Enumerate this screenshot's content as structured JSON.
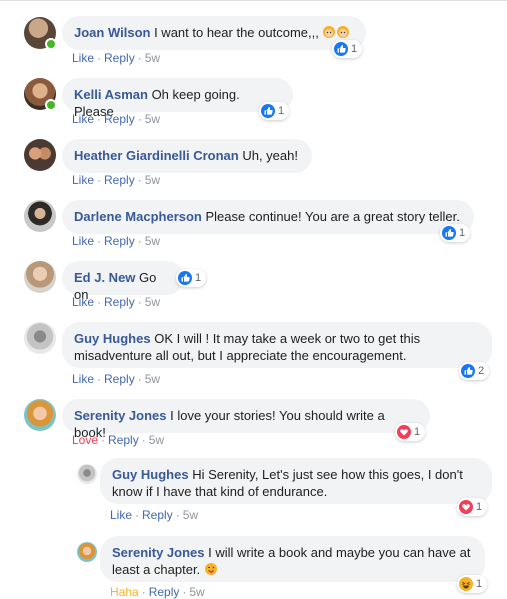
{
  "comments": [
    {
      "name": "Joan Wilson",
      "text": "I want to hear the outcome,,,",
      "like": "Like",
      "reply": "Reply",
      "time": "5w",
      "reaction_count": "1"
    },
    {
      "name": "Kelli Asman",
      "text": "Oh keep going. Please",
      "like": "Like",
      "reply": "Reply",
      "time": "5w",
      "reaction_count": "1"
    },
    {
      "name": "Heather Giardinelli Cronan",
      "text": "Uh, yeah!",
      "like": "Like",
      "reply": "Reply",
      "time": "5w"
    },
    {
      "name": "Darlene Macpherson",
      "text": "Please continue! You are a great story teller.",
      "like": "Like",
      "reply": "Reply",
      "time": "5w",
      "reaction_count": "1"
    },
    {
      "name": "Ed J. New",
      "text": "Go on",
      "like": "Like",
      "reply": "Reply",
      "time": "5w",
      "reaction_count": "1"
    },
    {
      "name": "Guy Hughes",
      "text_line1": "OK I will ! It may take a week or two to get this",
      "text_line2": "misadventure all out, but I appreciate the encouragement.",
      "like": "Like",
      "reply": "Reply",
      "time": "5w",
      "reaction_count": "2"
    },
    {
      "name": "Serenity Jones",
      "text": "I love your stories! You should write a book!",
      "like": "Love",
      "reply": "Reply",
      "time": "5w",
      "reaction_count": "1"
    }
  ],
  "replies": [
    {
      "name": "Guy Hughes",
      "text_line1": "Hi Serenity, Let's just see how this goes, I don't",
      "text_line2": "know if I have that kind of endurance.",
      "like": "Like",
      "reply": "Reply",
      "time": "5w",
      "reaction_count": "1"
    },
    {
      "name": "Serenity Jones",
      "text_line1": "I will write a book and maybe you can have at",
      "text_line2": "least a chapter.",
      "like": "Haha",
      "reply": "Reply",
      "time": "5w",
      "reaction_count": "1"
    }
  ],
  "colors": {
    "name": "#385898",
    "link": "#4267b2",
    "love": "#f33e58",
    "haha": "#f7b125",
    "bubble": "#f2f3f5"
  },
  "icons": {
    "like": "thumbs-up-icon",
    "love": "heart-icon",
    "haha": "laughing-face-icon",
    "emoji": "woman-emoji-icon",
    "tongue": "winking-tongue-emoji-icon"
  }
}
